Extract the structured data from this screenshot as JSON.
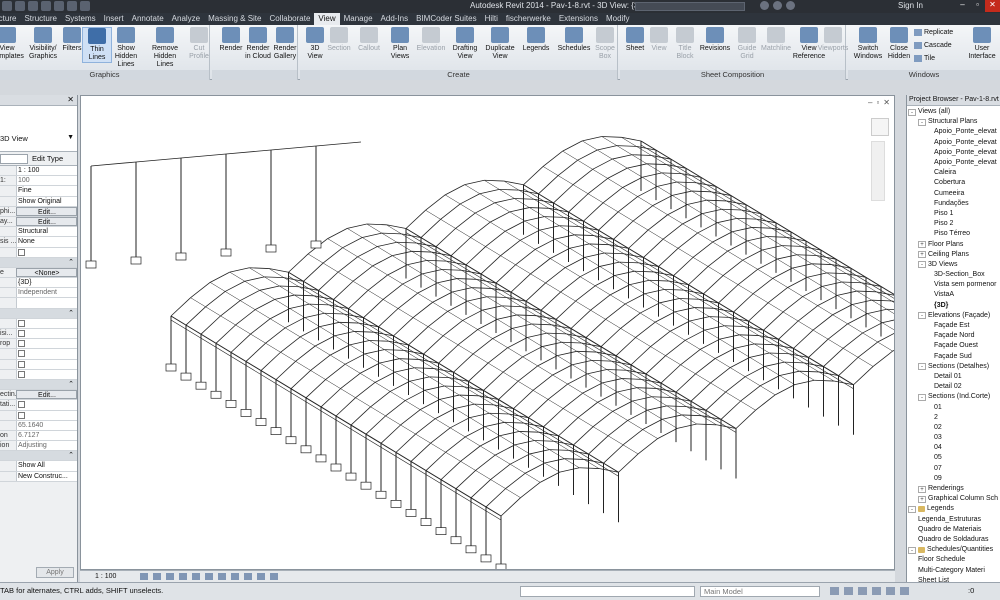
{
  "titlebar": {
    "title": "Autodesk Revit 2014 -    Pav-1-8.rvt - 3D View: {3D}",
    "signin": "Sign In"
  },
  "tabs": [
    "tecture",
    "Structure",
    "Systems",
    "Insert",
    "Annotate",
    "Analyze",
    "Massing & Site",
    "Collaborate",
    "View",
    "Manage",
    "Add-Ins",
    "BIMCoder Suites",
    "Hilti",
    "fischerwerke",
    "Extensions",
    "Modify"
  ],
  "active_tab": "View",
  "ribbon": {
    "graphics": {
      "label": "Graphics",
      "buttons": [
        "View\nTemplates",
        "Visibility/\nGraphics",
        "Filters",
        "Thin\nLines",
        "Show\nHidden Lines",
        "Remove\nHidden Lines",
        "Cut\nProfile"
      ]
    },
    "render": {
      "buttons": [
        "Render",
        "Render\nin Cloud",
        "Render\nGallery"
      ]
    },
    "create": {
      "label": "Create",
      "buttons": [
        "3D\nView",
        "Section",
        "Callout",
        "Plan\nViews",
        "Elevation",
        "Drafting\nView",
        "Duplicate\nView",
        "Legends",
        "Schedules",
        "Scope\nBox"
      ]
    },
    "sheet": {
      "label": "Sheet Composition",
      "buttons": [
        "Sheet",
        "View",
        "Title\nBlock",
        "Revisions",
        "Guide\nGrid",
        "Matchline",
        "View\nReference",
        "Viewports"
      ]
    },
    "windows": {
      "label": "Windows",
      "buttons": [
        "Switch\nWindows",
        "Close\nHidden"
      ],
      "small": [
        "Replicate",
        "Cascade",
        "Tile"
      ],
      "ui": "User\nInterface"
    }
  },
  "properties": {
    "type_value": "3D View",
    "edit_type": "Edit Type",
    "rows": [
      {
        "k": "",
        "v": "1 : 100",
        "kind": "val"
      },
      {
        "k": "1:",
        "v": "100",
        "kind": "grey"
      },
      {
        "k": "",
        "v": "Fine",
        "kind": "val"
      },
      {
        "k": "",
        "v": "Show Original",
        "kind": "val"
      },
      {
        "k": "phi...",
        "v": "Edit...",
        "kind": "btn"
      },
      {
        "k": "ay...",
        "v": "Edit...",
        "kind": "btn"
      },
      {
        "k": "",
        "v": "Structural",
        "kind": "val"
      },
      {
        "k": "sis ...",
        "v": "None",
        "kind": "val"
      },
      {
        "k": "",
        "v": "",
        "kind": "cb"
      },
      {
        "k": "",
        "v": "",
        "kind": "sect"
      },
      {
        "k": "e",
        "v": "<None>",
        "kind": "btn"
      },
      {
        "k": "",
        "v": "{3D}",
        "kind": "val"
      },
      {
        "k": "",
        "v": "Independent",
        "kind": "grey"
      },
      {
        "k": "",
        "v": "",
        "kind": "blank"
      },
      {
        "k": "",
        "v": "",
        "kind": "sect"
      },
      {
        "k": "",
        "v": "",
        "kind": "cb"
      },
      {
        "k": "isi...",
        "v": "",
        "kind": "cb"
      },
      {
        "k": "rop",
        "v": "",
        "kind": "cb"
      },
      {
        "k": "",
        "v": "",
        "kind": "cb"
      },
      {
        "k": "",
        "v": "",
        "kind": "cb"
      },
      {
        "k": "",
        "v": "",
        "kind": "cb"
      },
      {
        "k": "",
        "v": "",
        "kind": "sect"
      },
      {
        "k": "ectin...",
        "v": "Edit...",
        "kind": "btn"
      },
      {
        "k": "tati...",
        "v": "",
        "kind": "cb"
      },
      {
        "k": "",
        "v": "",
        "kind": "cb"
      },
      {
        "k": "",
        "v": "65.1640",
        "kind": "grey"
      },
      {
        "k": "on",
        "v": "6.7127",
        "kind": "grey"
      },
      {
        "k": "ion",
        "v": "Adjusting",
        "kind": "grey"
      },
      {
        "k": "",
        "v": "",
        "kind": "sect"
      },
      {
        "k": "",
        "v": "Show All",
        "kind": "val"
      },
      {
        "k": "",
        "v": "New Construc...",
        "kind": "val"
      }
    ],
    "apply": "Apply"
  },
  "viewbar": {
    "scale": "1 : 100"
  },
  "browser": {
    "title": "Project Browser - Pav-1-8.rvt",
    "nodes": [
      {
        "t": "Views (all)",
        "l": 0,
        "e": "-"
      },
      {
        "t": "Structural Plans",
        "l": 1,
        "e": "-"
      },
      {
        "t": "Apoio_Ponte_elevat",
        "l": 2
      },
      {
        "t": "Apoio_Ponte_elevat",
        "l": 2
      },
      {
        "t": "Apoio_Ponte_elevat",
        "l": 2
      },
      {
        "t": "Apoio_Ponte_elevat",
        "l": 2
      },
      {
        "t": "Caleira",
        "l": 2
      },
      {
        "t": "Cobertura",
        "l": 2
      },
      {
        "t": "Cumeeira",
        "l": 2
      },
      {
        "t": "Fundações",
        "l": 2
      },
      {
        "t": "Piso 1",
        "l": 2
      },
      {
        "t": "Piso 2",
        "l": 2
      },
      {
        "t": "Piso Térreo",
        "l": 2
      },
      {
        "t": "Floor Plans",
        "l": 1,
        "e": "+"
      },
      {
        "t": "Ceiling Plans",
        "l": 1,
        "e": "+"
      },
      {
        "t": "3D Views",
        "l": 1,
        "e": "-"
      },
      {
        "t": "3D-Section_Box",
        "l": 2
      },
      {
        "t": "Vista sem pormenor",
        "l": 2
      },
      {
        "t": "VistaA",
        "l": 2
      },
      {
        "t": "{3D}",
        "l": 2,
        "bold": true
      },
      {
        "t": "Elevations (Façade)",
        "l": 1,
        "e": "-"
      },
      {
        "t": "Façade Est",
        "l": 2
      },
      {
        "t": "Façade Nord",
        "l": 2
      },
      {
        "t": "Façade Ouest",
        "l": 2
      },
      {
        "t": "Façade Sud",
        "l": 2
      },
      {
        "t": "Sections (Detalhes)",
        "l": 1,
        "e": "-"
      },
      {
        "t": "Detail 01",
        "l": 2
      },
      {
        "t": "Detail 02",
        "l": 2
      },
      {
        "t": "Sections (Ind.Corte)",
        "l": 1,
        "e": "-"
      },
      {
        "t": "01",
        "l": 2
      },
      {
        "t": "2",
        "l": 2
      },
      {
        "t": "02",
        "l": 2
      },
      {
        "t": "03",
        "l": 2
      },
      {
        "t": "04",
        "l": 2
      },
      {
        "t": "05",
        "l": 2
      },
      {
        "t": "07",
        "l": 2
      },
      {
        "t": "09",
        "l": 2
      },
      {
        "t": "Renderings",
        "l": 1,
        "e": "+"
      },
      {
        "t": "Graphical Column Sch",
        "l": 1,
        "e": "+"
      },
      {
        "t": "Legends",
        "l": 0,
        "e": "-",
        "folder": true
      },
      {
        "t": "Legenda_Estruturas",
        "l": 1
      },
      {
        "t": "Quadro de Materiais",
        "l": 1
      },
      {
        "t": "Quadro de Soldaduras",
        "l": 1
      },
      {
        "t": "Schedules/Quantities",
        "l": 0,
        "e": "-",
        "folder": true
      },
      {
        "t": "Floor Schedule",
        "l": 1
      },
      {
        "t": "Multi-Category Materi",
        "l": 1
      },
      {
        "t": "Sheet List",
        "l": 1
      }
    ]
  },
  "status": {
    "message": "TAB for alternates, CTRL adds, SHIFT unselects.",
    "model": "Main Model",
    "filter": ":0"
  }
}
